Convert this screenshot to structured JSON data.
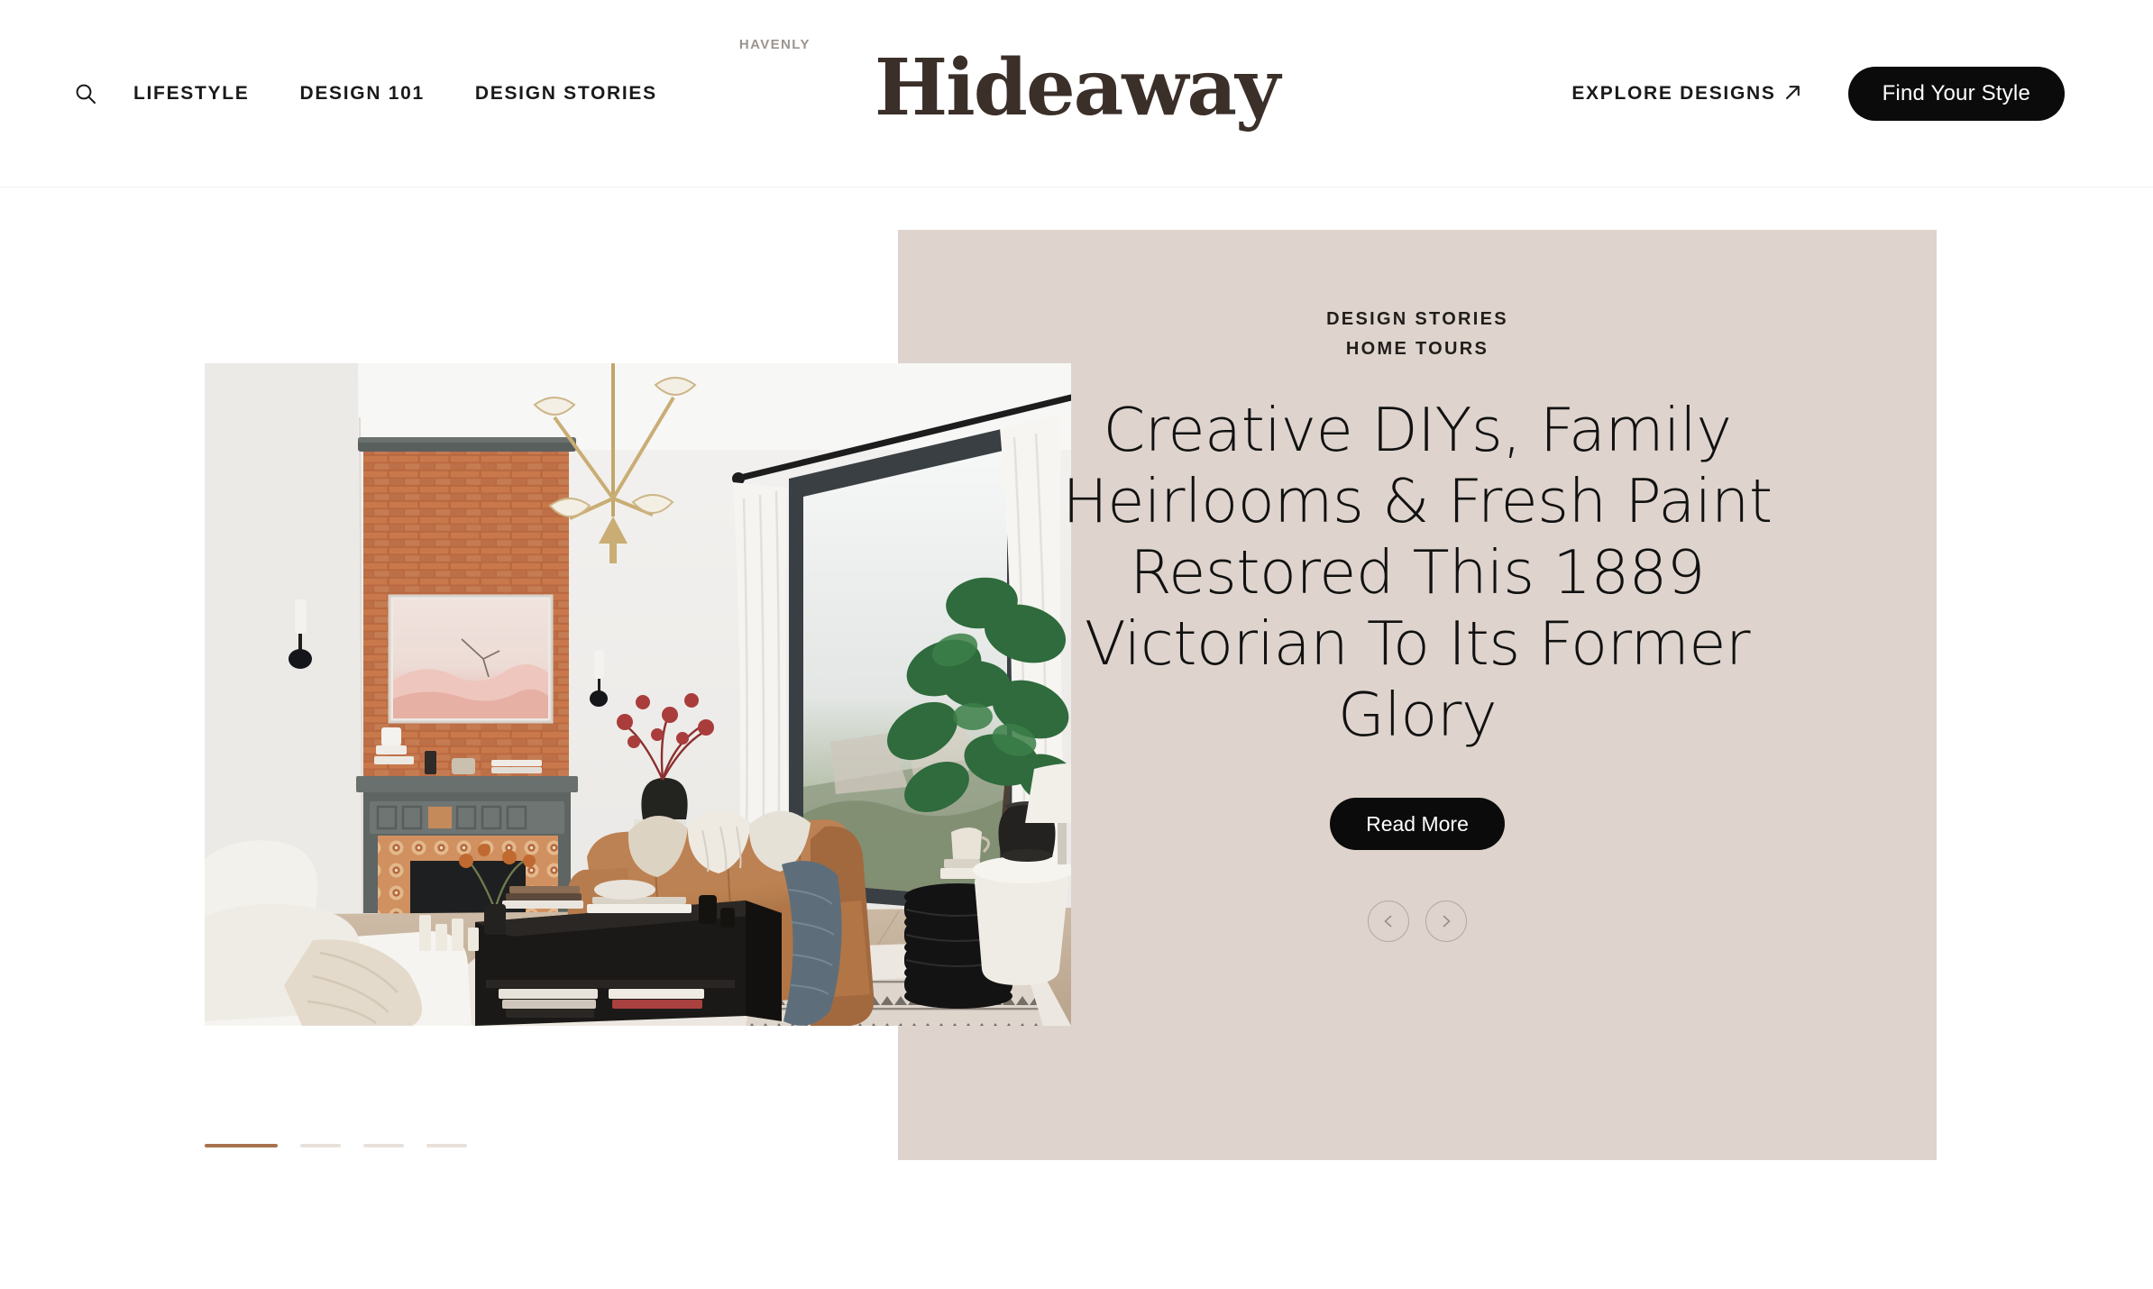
{
  "header": {
    "search_icon": "search-icon",
    "nav_links": [
      {
        "label": "Lifestyle"
      },
      {
        "label": "Design 101"
      },
      {
        "label": "Design Stories"
      }
    ],
    "logo": {
      "kicker": "Havenly",
      "word": "Hideaway",
      "color": "#3b2f29"
    },
    "explore": {
      "label": "Explore Designs",
      "icon": "arrow-up-right-icon"
    },
    "cta": {
      "label": "Find Your Style",
      "bg": "#0b0b0b",
      "fg": "#ffffff"
    }
  },
  "hero": {
    "panel_color": "#ded4cd",
    "eyebrows": [
      "Design Stories",
      "Home Tours"
    ],
    "title": "Creative DIYs, Family Heirlooms & Fresh Paint Restored This 1889 Victorian To Its Former Glory",
    "read_more": "Read More",
    "prev_icon": "chevron-left-icon",
    "next_icon": "chevron-right-icon",
    "photo_alt": "Victorian living room with exposed brick fireplace, camel leather sofa and fiddle leaf fig",
    "progress": {
      "total": 4,
      "active_index": 0,
      "active_color": "#a8724f",
      "idle_color": "#e8e1db"
    }
  }
}
